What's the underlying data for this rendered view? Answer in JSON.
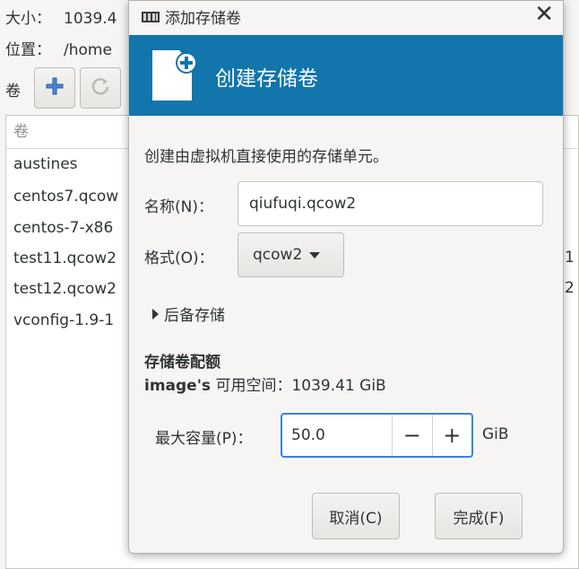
{
  "background": {
    "size_label": "大小：",
    "size_value": "1039.4",
    "location_label": "位置：",
    "location_value": "/home",
    "volumes_label": "卷",
    "list_header": "卷",
    "volumes": [
      "austines",
      "centos7.qcow",
      "centos-7-x86",
      "test11.qcow2",
      "test12.qcow2",
      "vconfig-1.9-1"
    ],
    "right_digits": [
      "1",
      "2"
    ]
  },
  "dialog": {
    "title": "添加存储卷",
    "close": "✕",
    "banner_title": "创建存储卷",
    "description": "创建由虚拟机直接使用的存储单元。",
    "name_label": "名称(N)：",
    "name_value": "qiufuqi.qcow2",
    "format_label": "格式(O)：",
    "format_value": "qcow2",
    "backing_label": "后备存储",
    "quota_title": "存储卷配额",
    "pool_name": "image's",
    "available_text": "可用空间：1039.41 GiB",
    "max_label": "最大容量(P)：",
    "max_value": "50.0",
    "minus": "−",
    "plus": "+",
    "unit": "GiB",
    "cancel": "取消(C)",
    "finish": "完成(F)"
  }
}
